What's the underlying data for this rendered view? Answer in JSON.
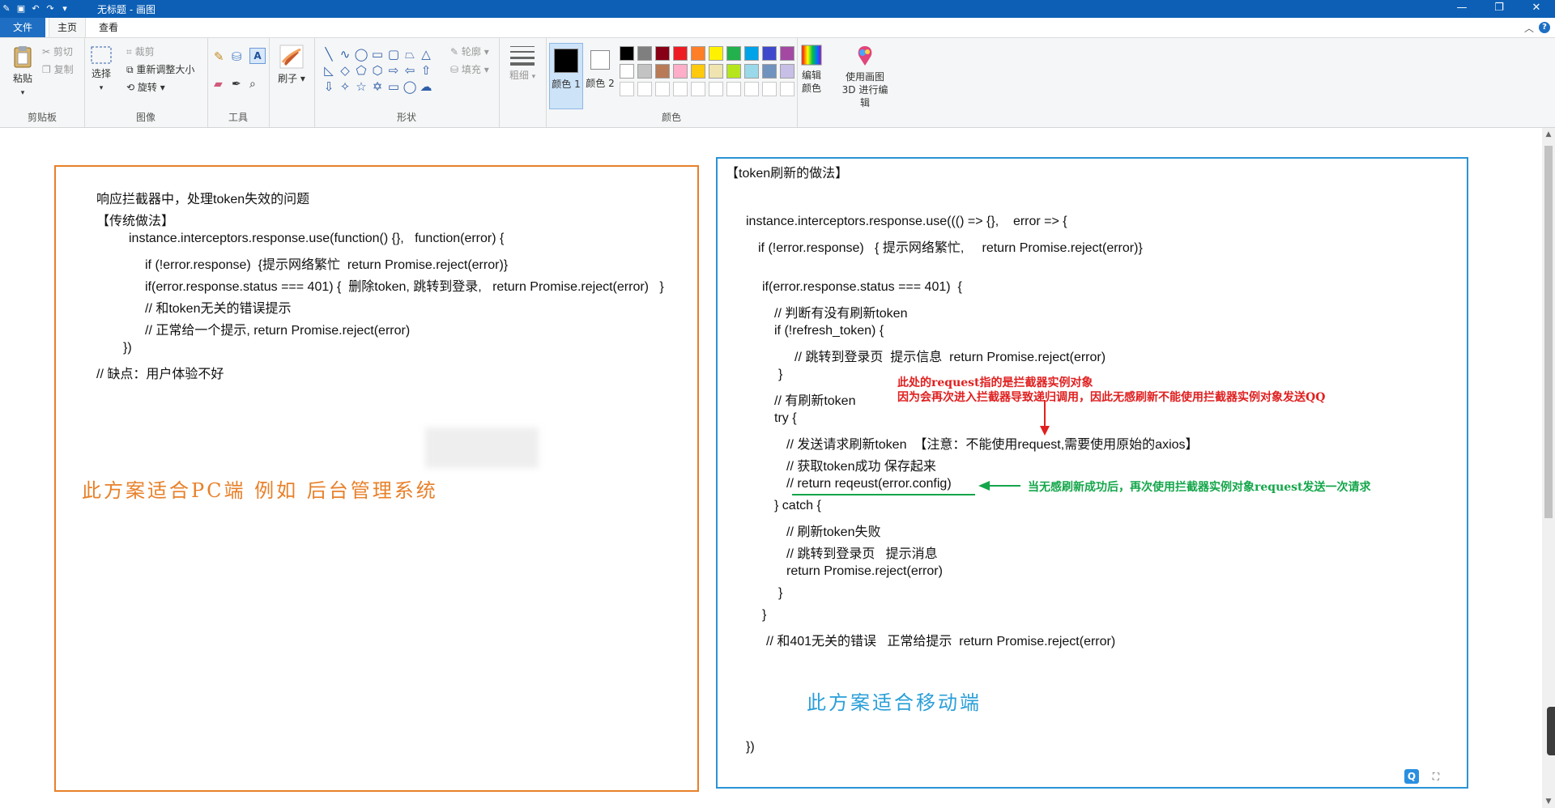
{
  "window": {
    "title": "无标题 - 画图"
  },
  "menu": {
    "file": "文件",
    "home": "主页",
    "view": "查看"
  },
  "ribbon": {
    "clipboard": {
      "paste": "粘贴",
      "cut": "剪切",
      "copy": "复制",
      "label": "剪贴板"
    },
    "image": {
      "select": "选择",
      "crop": "裁剪",
      "resize": "重新调整大小",
      "rotate": "旋转",
      "label": "图像"
    },
    "tools": {
      "label": "工具"
    },
    "brushes": {
      "label": "刷子"
    },
    "shapes": {
      "outline": "轮廓",
      "fill": "填充",
      "label": "形状"
    },
    "size": {
      "label": "粗细"
    },
    "color1": "颜色 1",
    "color2": "颜色 2",
    "colors": {
      "edit": "编辑颜色",
      "label": "颜色",
      "paint3d": "使用画图 3D 进行编辑",
      "row1": [
        "#000000",
        "#7f7f7f",
        "#880015",
        "#ed1c24",
        "#ff7f27",
        "#fff200",
        "#22b14c",
        "#00a2e8",
        "#3f48cc",
        "#a349a4"
      ],
      "row2": [
        "#ffffff",
        "#c3c3c3",
        "#b97a57",
        "#ffaec9",
        "#ffc90e",
        "#efe4b0",
        "#b5e61d",
        "#99d9ea",
        "#7092be",
        "#c8bfe7"
      ],
      "row3": [
        "#ffffff",
        "#ffffff",
        "#ffffff",
        "#ffffff",
        "#ffffff",
        "#ffffff",
        "#ffffff",
        "#ffffff",
        "#ffffff",
        "#ffffff"
      ]
    }
  },
  "left_panel": {
    "lines": [
      "响应拦截器中，处理token失效的问题",
      "【传统做法】",
      "instance.interceptors.response.use(function() {},   function(error) {",
      "if (!error.response)  {提示网络繁忙  return Promise.reject(error)}",
      "if(error.response.status === 401) {  删除token, 跳转到登录,   return Promise.reject(error)   }",
      "// 和token无关的错误提示",
      "// 正常给一个提示, return Promise.reject(error)",
      "})",
      "// 缺点：用户体验不好"
    ],
    "note": "此方案适合PC端  例如  后台管理系统"
  },
  "right_panel": {
    "lines": [
      "【token刷新的做法】",
      "instance.interceptors.response.use((() => {},    error => {",
      "if (!error.response)   { 提示网络繁忙,     return Promise.reject(error)}",
      "if(error.response.status === 401)  {",
      "// 判断有没有刷新token",
      "if (!refresh_token) {",
      "// 跳转到登录页  提示信息  return Promise.reject(error)",
      "}",
      "// 有刷新token",
      "try {",
      "// 发送请求刷新token  【注意：不能使用request,需要使用原始的axios】",
      "// 获取token成功 保存起来",
      "// return reqeust(error.config)",
      "} catch {",
      "// 刷新token失败",
      "// 跳转到登录页   提示消息",
      "return Promise.reject(error)",
      "}",
      "}",
      "// 和401无关的错误   正常给提示  return Promise.reject(error)",
      "})"
    ],
    "red_note_1": "此处的request指的是拦截器实例对象",
    "red_note_2": "因为会再次进入拦截器导致递归调用，因此无感刷新不能使用拦截器实例对象发送QQ",
    "green_note": "当无感刷新成功后，再次使用拦截器实例对象request发送一次请求",
    "note": "此方案适合移动端"
  }
}
